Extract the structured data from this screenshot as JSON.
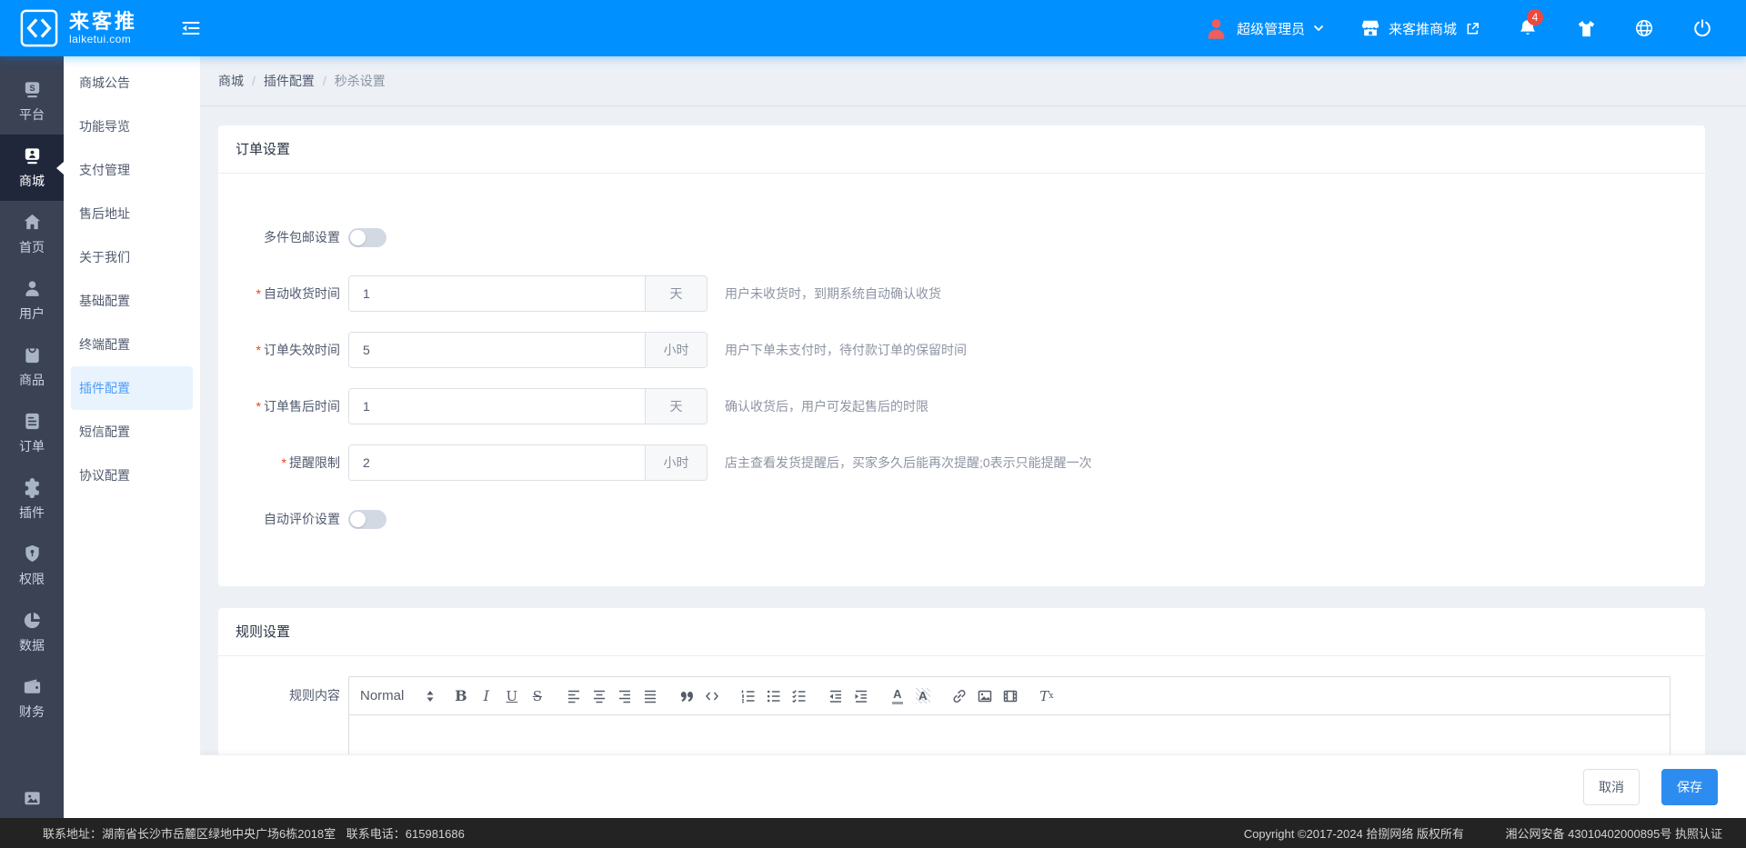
{
  "header": {
    "brand": "来客推",
    "domain": "laiketui.com",
    "user_role": "超级管理员",
    "shop_name": "来客推商城",
    "notification_count": "4"
  },
  "primary_nav": {
    "items": [
      {
        "label": "平台",
        "icon": "platform-s-icon",
        "active": false
      },
      {
        "label": "商城",
        "icon": "mall-card-icon",
        "active": true
      },
      {
        "label": "首页",
        "icon": "home-icon",
        "active": false
      },
      {
        "label": "用户",
        "icon": "user-icon",
        "active": false
      },
      {
        "label": "商品",
        "icon": "goods-bag-icon",
        "active": false
      },
      {
        "label": "订单",
        "icon": "order-clipboard-icon",
        "active": false
      },
      {
        "label": "插件",
        "icon": "plugin-puzzle-icon",
        "active": false
      },
      {
        "label": "权限",
        "icon": "permission-shield-icon",
        "active": false
      },
      {
        "label": "数据",
        "icon": "data-pie-icon",
        "active": false
      },
      {
        "label": "财务",
        "icon": "finance-wallet-icon",
        "active": false
      },
      {
        "label": "",
        "icon": "gallery-icon",
        "active": false
      }
    ]
  },
  "secondary_nav": {
    "items": [
      {
        "label": "商城公告",
        "active": false
      },
      {
        "label": "功能导览",
        "active": false
      },
      {
        "label": "支付管理",
        "active": false
      },
      {
        "label": "售后地址",
        "active": false
      },
      {
        "label": "关于我们",
        "active": false
      },
      {
        "label": "基础配置",
        "active": false
      },
      {
        "label": "终端配置",
        "active": false
      },
      {
        "label": "插件配置",
        "active": true
      },
      {
        "label": "短信配置",
        "active": false
      },
      {
        "label": "协议配置",
        "active": false
      }
    ]
  },
  "breadcrumb": {
    "separator": "/",
    "items": [
      "商城",
      "插件配置",
      "秒杀设置"
    ]
  },
  "order_card": {
    "title": "订单设置",
    "required_marker": "*",
    "toggle_top": {
      "label": "多件包邮设置",
      "on": false
    },
    "toggle_bottom": {
      "label": "自动评价设置",
      "on": false
    },
    "fields": [
      {
        "label": "自动收货时间",
        "required": true,
        "value": "1",
        "unit": "天",
        "hint": "用户未收货时，到期系统自动确认收货"
      },
      {
        "label": "订单失效时间",
        "required": true,
        "value": "5",
        "unit": "小时",
        "hint": "用户下单未支付时，待付款订单的保留时间"
      },
      {
        "label": "订单售后时间",
        "required": true,
        "value": "1",
        "unit": "天",
        "hint": "确认收货后，用户可发起售后的时限"
      },
      {
        "label": "提醒限制",
        "required": true,
        "value": "2",
        "unit": "小时",
        "hint": "店主查看发货提醒后，买家多久后能再次提醒;0表示只能提醒一次"
      }
    ]
  },
  "rule_card": {
    "title": "规则设置",
    "editor_label": "规则内容",
    "toolbar": {
      "format": "Normal",
      "bold": "B",
      "italic": "I",
      "underline": "U",
      "strike": "S",
      "color": "A",
      "background": "A",
      "clear": "T",
      "clear_sub": "x"
    }
  },
  "actions": {
    "cancel": "取消",
    "save": "保存"
  },
  "footer": {
    "address": "联系地址：湖南省长沙市岳麓区绿地中央广场6栋2018室",
    "phone": "联系电话：615981686",
    "copyright": "Copyright ©2017-2024 拾捌网络 版权所有",
    "icp": "湘公网安备 43010402000895号 执照认证"
  },
  "colors": {
    "header_blue": "#0090ff",
    "primary_blue": "#2d8cf0",
    "secondary_active_text": "#4d9ef6",
    "secondary_active_bg": "#e8f3fe",
    "sidebar_bg": "#3a4254",
    "sidebar_active_bg": "#20273a",
    "badge_red": "#f0483e",
    "avatar_red": "#ef5d5d",
    "required_red": "#ed4014",
    "footer_bg": "#232323",
    "content_bg": "#edf0f5"
  }
}
